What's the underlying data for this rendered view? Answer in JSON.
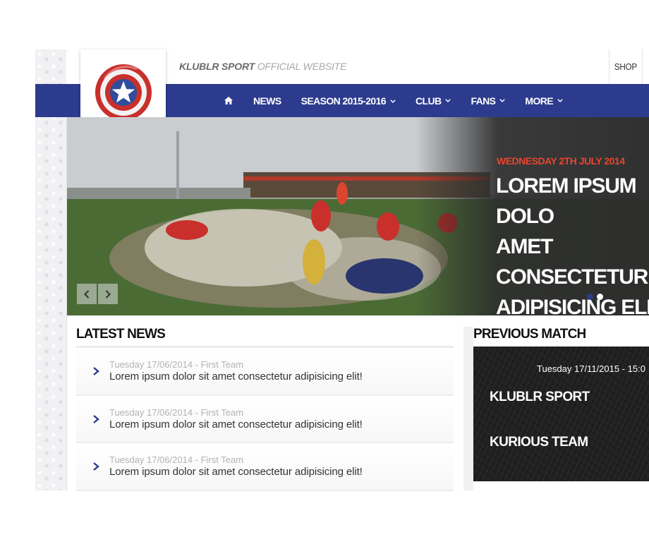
{
  "header": {
    "brand": "KLUBLR SPORT",
    "tagline": "OFFICIAL WEBSITE",
    "shop_label": "SHOP"
  },
  "nav": {
    "home_icon": "home-icon",
    "items": [
      {
        "label": "NEWS",
        "dropdown": false
      },
      {
        "label": "SEASON 2015-2016",
        "dropdown": true
      },
      {
        "label": "CLUB",
        "dropdown": true
      },
      {
        "label": "FANS",
        "dropdown": true
      },
      {
        "label": "MORE",
        "dropdown": true
      }
    ]
  },
  "hero": {
    "date": "WEDNESDAY 2TH JULY 2014",
    "headline": "LOREM IPSUM DOLO\nAMET CONSECTETUR\nADIPISICING ELIT!",
    "prev_icon": "chevron-left-icon",
    "next_icon": "chevron-right-icon",
    "dots": 2,
    "active_dot": 0
  },
  "latest_news": {
    "heading": "LATEST NEWS",
    "items": [
      {
        "meta": "Tuesday 17/06/2014 - First Team",
        "title": "Lorem ipsum dolor sit amet consectetur adipisicing elit!"
      },
      {
        "meta": "Tuesday 17/06/2014 - First Team",
        "title": "Lorem ipsum dolor sit amet consectetur adipisicing elit!"
      },
      {
        "meta": "Tuesday 17/06/2014 - First Team",
        "title": "Lorem ipsum dolor sit amet consectetur adipisicing elit!"
      }
    ]
  },
  "previous_match": {
    "heading": "PREVIOUS MATCH",
    "date": "Tuesday 17/11/2015 - 15:0",
    "home_team": "KLUBLR SPORT",
    "away_team": "KURIOUS TEAM"
  },
  "colors": {
    "nav_blue": "#2c3b8d",
    "accent_red": "#e8452f",
    "match_bg": "#202020"
  }
}
